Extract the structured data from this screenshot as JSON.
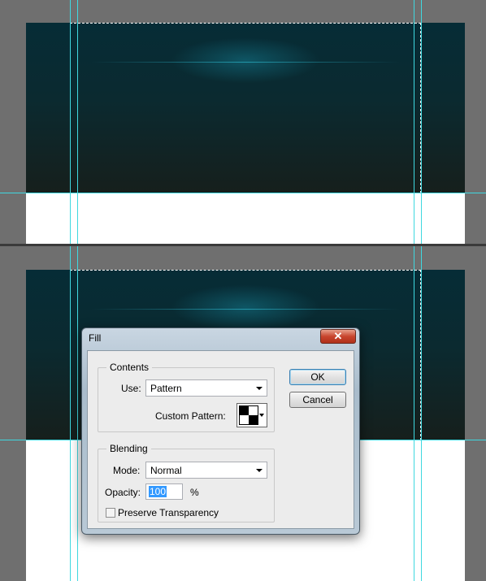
{
  "colors": {
    "guide": "#3fd8e0",
    "canvas_top": "#062c36",
    "canvas_bottom": "#161f1c",
    "dialog_frame": "#b9c9d6",
    "selection_highlight": "#3399ff",
    "close_button": "#c8452e"
  },
  "fill_dialog": {
    "title": "Fill",
    "close_icon": "close-icon",
    "contents": {
      "legend": "Contents",
      "use_label": "Use:",
      "use_value": "Pattern",
      "custom_pattern_label": "Custom Pattern:",
      "pattern_icon": "checker-pattern-icon"
    },
    "blending": {
      "legend": "Blending",
      "mode_label": "Mode:",
      "mode_value": "Normal",
      "opacity_label": "Opacity:",
      "opacity_value": "100",
      "opacity_unit": "%",
      "preserve_transparency_label": "Preserve Transparency",
      "preserve_transparency_checked": false
    },
    "buttons": {
      "ok": "OK",
      "cancel": "Cancel"
    }
  }
}
